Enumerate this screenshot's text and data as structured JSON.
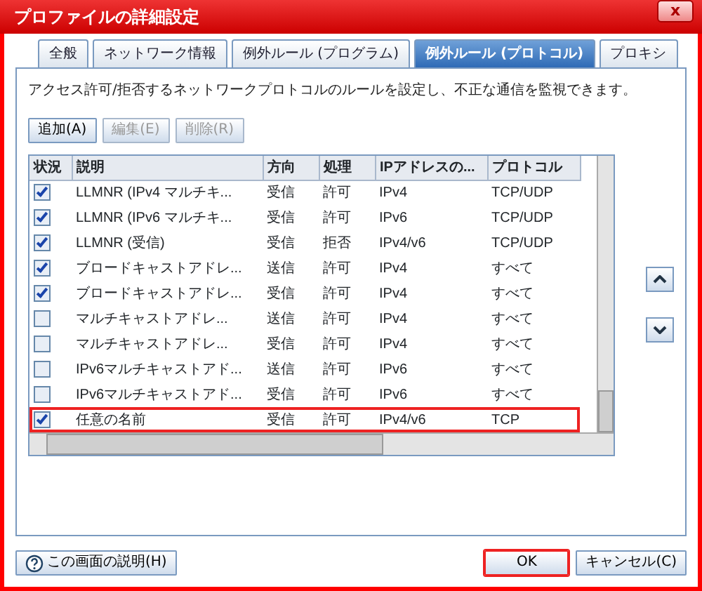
{
  "window": {
    "title": "プロファイルの詳細設定",
    "close": "x"
  },
  "tabs": [
    {
      "label": "全般",
      "selected": false
    },
    {
      "label": "ネットワーク情報",
      "selected": false
    },
    {
      "label": "例外ルール (プログラム)",
      "selected": false
    },
    {
      "label": "例外ルール (プロトコル)",
      "selected": true
    },
    {
      "label": "プロキシ",
      "selected": false
    }
  ],
  "description": "アクセス許可/拒否するネットワークプロトコルのルールを設定し、不正な通信を監視できます。",
  "toolbar": [
    {
      "label": "追加(A)",
      "disabled": false
    },
    {
      "label": "編集(E)",
      "disabled": true
    },
    {
      "label": "削除(R)",
      "disabled": true
    }
  ],
  "table": {
    "columns": [
      "状況",
      "説明",
      "方向",
      "処理",
      "IPアドレスの...",
      "プロトコル"
    ],
    "rows": [
      {
        "checked": true,
        "highlighted": false,
        "description": "LLMNR (IPv4 マルチキ...",
        "direction": "受信",
        "action": "許可",
        "ip_version": "IPv4",
        "protocol": "TCP/UDP"
      },
      {
        "checked": true,
        "highlighted": false,
        "description": "LLMNR (IPv6 マルチキ...",
        "direction": "受信",
        "action": "許可",
        "ip_version": "IPv6",
        "protocol": "TCP/UDP"
      },
      {
        "checked": true,
        "highlighted": false,
        "description": "LLMNR (受信)",
        "direction": "受信",
        "action": "拒否",
        "ip_version": "IPv4/v6",
        "protocol": "TCP/UDP"
      },
      {
        "checked": true,
        "highlighted": false,
        "description": "ブロードキャストアドレ...",
        "direction": "送信",
        "action": "許可",
        "ip_version": "IPv4",
        "protocol": "すべて"
      },
      {
        "checked": true,
        "highlighted": false,
        "description": "ブロードキャストアドレ...",
        "direction": "受信",
        "action": "許可",
        "ip_version": "IPv4",
        "protocol": "すべて"
      },
      {
        "checked": false,
        "highlighted": false,
        "description": "マルチキャストアドレ...",
        "direction": "送信",
        "action": "許可",
        "ip_version": "IPv4",
        "protocol": "すべて"
      },
      {
        "checked": false,
        "highlighted": false,
        "description": "マルチキャストアドレ...",
        "direction": "受信",
        "action": "許可",
        "ip_version": "IPv4",
        "protocol": "すべて"
      },
      {
        "checked": false,
        "highlighted": false,
        "description": "IPv6マルチキャストアド...",
        "direction": "送信",
        "action": "許可",
        "ip_version": "IPv6",
        "protocol": "すべて"
      },
      {
        "checked": false,
        "highlighted": false,
        "description": "IPv6マルチキャストアド...",
        "direction": "受信",
        "action": "許可",
        "ip_version": "IPv6",
        "protocol": "すべて"
      },
      {
        "checked": true,
        "highlighted": true,
        "description": "任意の名前",
        "direction": "受信",
        "action": "許可",
        "ip_version": "IPv4/v6",
        "protocol": "TCP"
      }
    ]
  },
  "footer": {
    "help": "この画面の説明(H)",
    "ok": "OK",
    "ok_highlighted": true,
    "cancel": "キャンセル(C)"
  }
}
